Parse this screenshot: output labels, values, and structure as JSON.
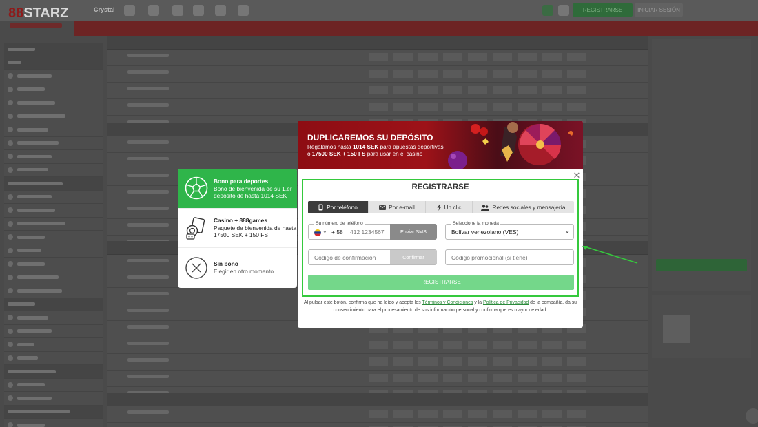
{
  "header": {
    "logo_text": "STARZ",
    "logo_mark": "88",
    "crystal_label": "Crystal",
    "register_button": "REGISTRARSE",
    "login_button": "INICIAR SESIÓN"
  },
  "bonus_options": [
    {
      "title": "Bono para deportes",
      "description": "Bono de bienvenida de su 1.er depósito de hasta 1014 SEK",
      "icon": "soccer-ball-icon",
      "selected": true
    },
    {
      "title": "Casino + 888games",
      "description": "Paquete de bienvenida de hasta 17500 SEK + 150 FS",
      "icon": "casino-chips-icon",
      "selected": false
    },
    {
      "title": "Sin bono",
      "description": "Elegir en otro momento",
      "icon": "no-bonus-icon",
      "selected": false
    }
  ],
  "promo": {
    "title": "DUPLICAREMOS SU DEPÓSITO",
    "line1_prefix": "Regalamos hasta ",
    "line1_amount": "1014 SEK",
    "line1_suffix": " para apuestas deportivas",
    "line2_prefix": "o ",
    "line2_amount": "17500 SEK + 150 FS",
    "line2_suffix": " para usar en el casino"
  },
  "register": {
    "title": "REGISTRARSE",
    "tabs": [
      {
        "label": "Por teléfono",
        "icon": "phone-icon",
        "active": true
      },
      {
        "label": "Por e-mail",
        "icon": "envelope-icon",
        "active": false
      },
      {
        "label": "Un clic",
        "icon": "lightning-icon",
        "active": false
      },
      {
        "label": "Redes sociales y mensajería",
        "icon": "users-icon",
        "active": false
      }
    ],
    "phone_label": "Su número de teléfono",
    "phone_prefix": "+ 58",
    "phone_placeholder": "412 1234567",
    "send_sms_button": "Enviar SMS",
    "currency_label": "Seleccione la moneda",
    "currency_value": "Bolívar venezolano (VES)",
    "confirmation_placeholder": "Código de confirmación",
    "confirm_button": "Confirmar",
    "promo_code_placeholder": "Código promocional (si tiene)",
    "submit_button": "REGISTRARSE",
    "terms_text_1": "Al pulsar este botón, confirma que ha leído y acepta los ",
    "terms_link": "Términos y Condiciones",
    "terms_text_2": " y la ",
    "privacy_link": "Política de Privacidad",
    "terms_text_3": " de la compañía, da su consentimiento para el procesamiento de sus información personal y confirma que es mayor de edad."
  },
  "colors": {
    "accent_green": "#2fb54a",
    "highlight_border": "#35c93d",
    "banner_red": "#9d1218",
    "link_green": "#2a8a3a"
  }
}
